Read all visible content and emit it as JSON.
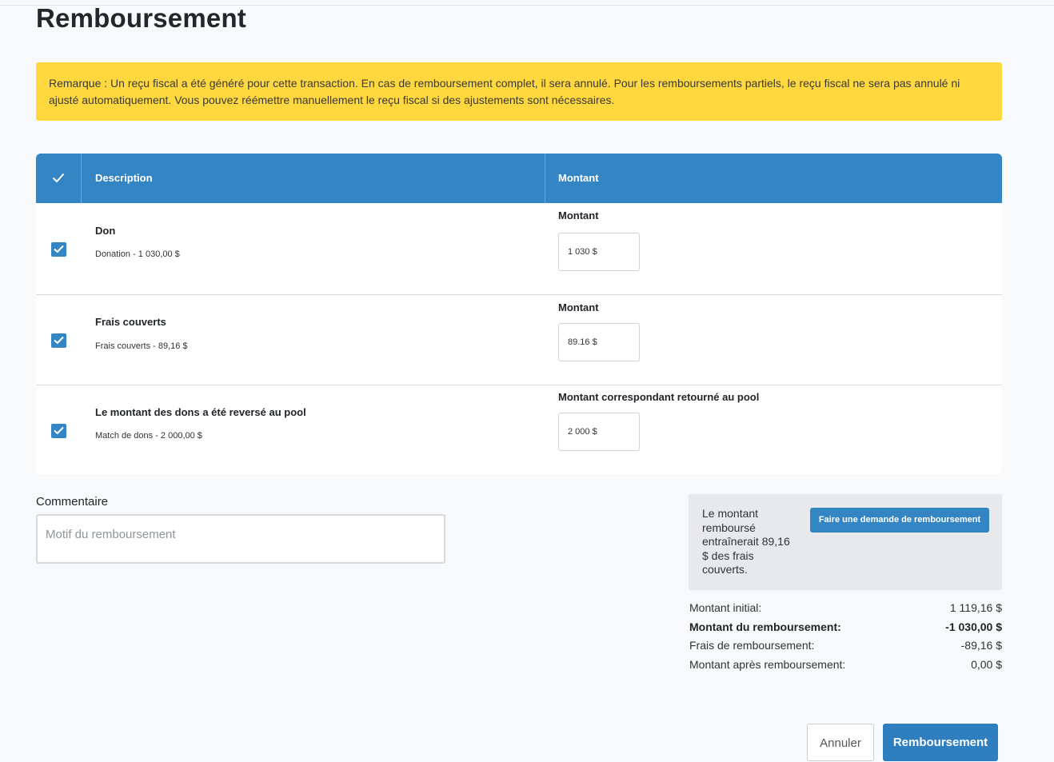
{
  "page": {
    "title": "Remboursement"
  },
  "alert": {
    "text": "Remarque : Un reçu fiscal a été généré pour cette transaction. En cas de remboursement complet, il sera annulé. Pour les remboursements partiels, le reçu fiscal ne sera pas annulé ni ajusté automatiquement. Vous pouvez réémettre manuellement le reçu fiscal si des ajustements sont nécessaires."
  },
  "table": {
    "headers": {
      "description": "Description",
      "amount": "Montant"
    },
    "select_all_checked": true,
    "rows": [
      {
        "title": "Don",
        "subtitle": "Donation - 1 030,00 $",
        "field_label": "Montant",
        "value": "1 030 $",
        "checked": true
      },
      {
        "title": "Frais couverts",
        "subtitle": "Frais couverts - 89,16 $",
        "field_label": "Montant",
        "value": "89.16 $",
        "checked": true
      },
      {
        "title": "Le montant des dons a été reversé au pool",
        "subtitle": "Match de dons - 2 000,00 $",
        "field_label": "Montant correspondant retourné au pool",
        "value": "2 000 $",
        "checked": true
      }
    ]
  },
  "comment": {
    "label": "Commentaire",
    "placeholder": "Motif du remboursement"
  },
  "info": {
    "text": "Le montant remboursé entraînerait 89,16 $ des frais couverts.",
    "button": "Faire une demande de remboursement"
  },
  "summary": {
    "initial_label": "Montant initial:",
    "initial_value": "1 119,16 $",
    "refund_label": "Montant du remboursement:",
    "refund_value": "-1 030,00 $",
    "fees_label": "Frais de remboursement:",
    "fees_value": "-89,16 $",
    "after_label": "Montant après remboursement:",
    "after_value": "0,00 $"
  },
  "actions": {
    "cancel": "Annuler",
    "refund": "Remboursement"
  },
  "colors": {
    "primary": "#3485c4",
    "alert": "#ffd73f"
  }
}
